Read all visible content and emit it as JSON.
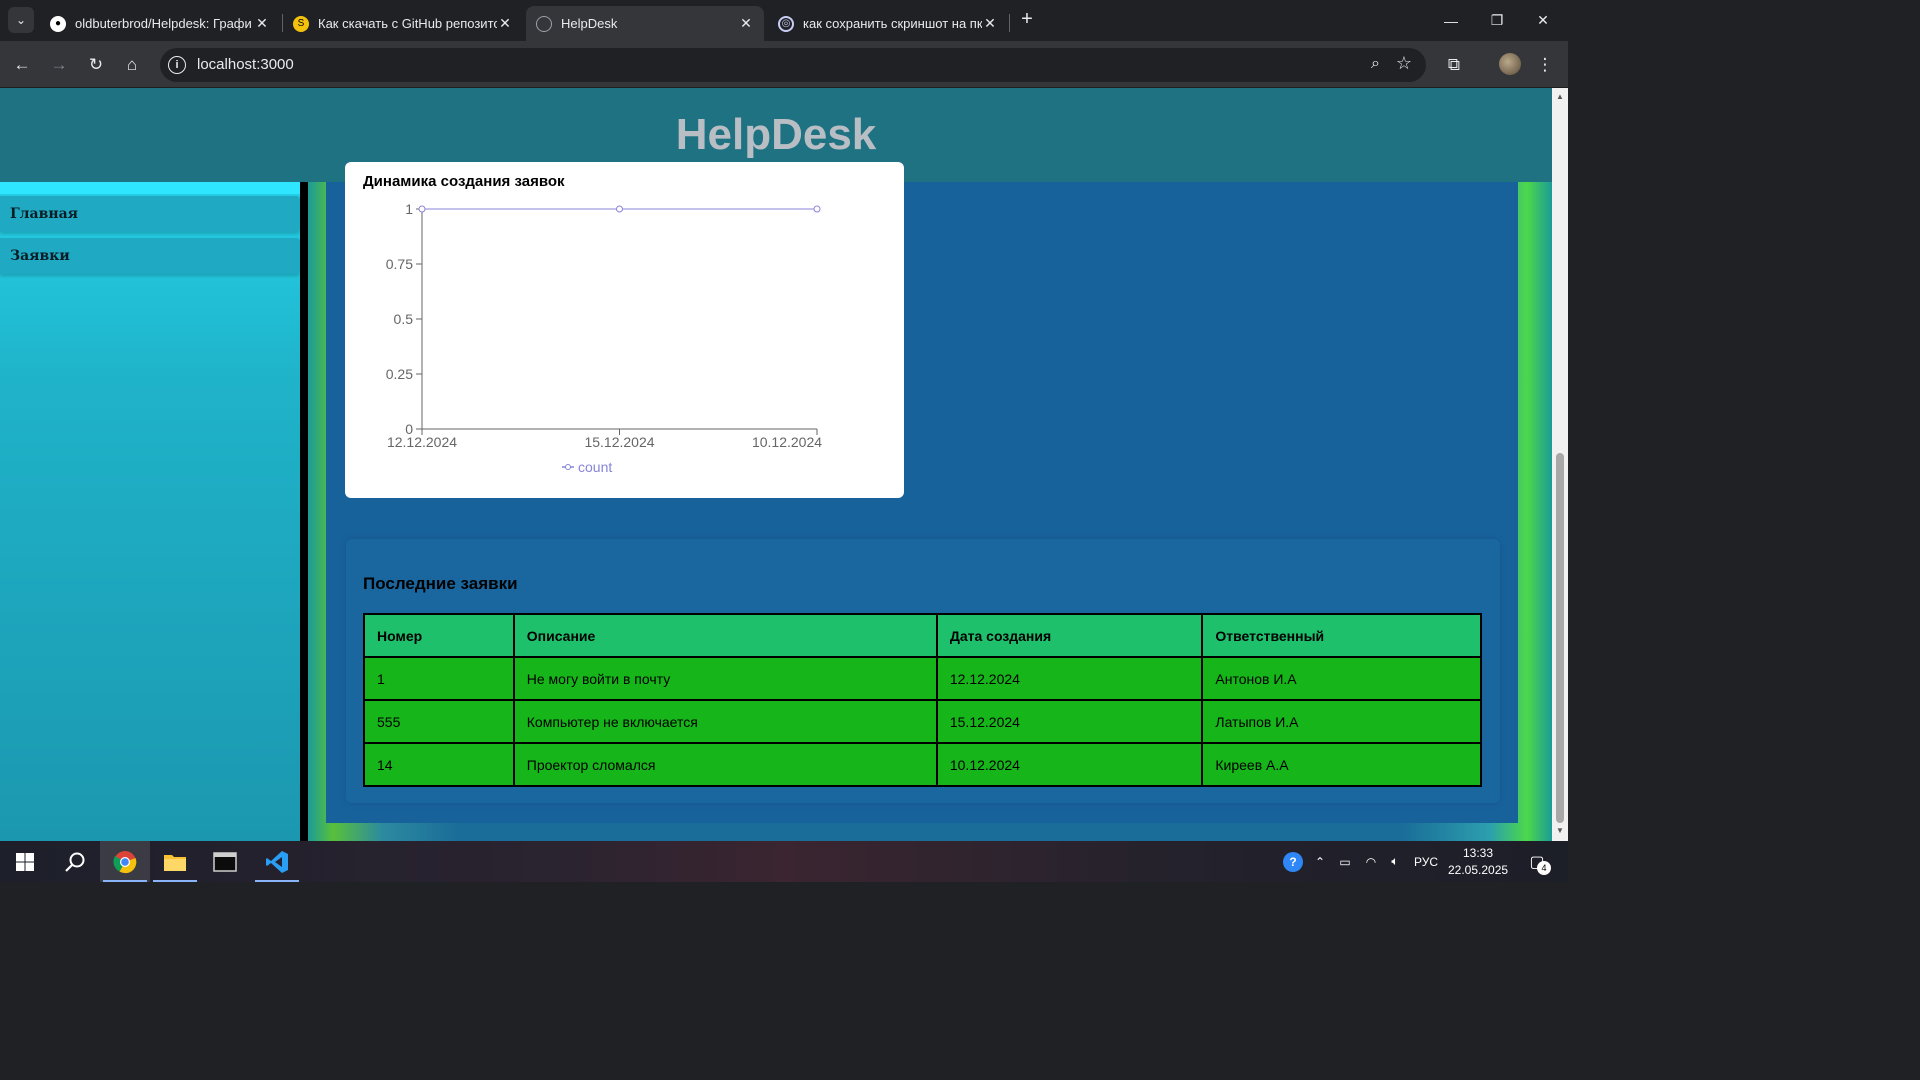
{
  "browser": {
    "tabs": [
      {
        "title": "oldbuterbrod/Helpdesk: Графи",
        "icon": "github-icon",
        "active": false
      },
      {
        "title": "Как скачать с GitHub репозито",
        "icon": "site-s-icon",
        "active": false
      },
      {
        "title": "HelpDesk",
        "icon": "globe-icon",
        "active": true
      },
      {
        "title": "как сохранить скриншот на пк",
        "icon": "search-engine-icon",
        "active": false
      }
    ],
    "url": "localhost:3000"
  },
  "app": {
    "title": "HelpDesk"
  },
  "sidebar": {
    "items": [
      {
        "label": "Главная"
      },
      {
        "label": "Заявки"
      }
    ]
  },
  "chart": {
    "title": "Динамика создания заявок"
  },
  "chart_data": {
    "type": "line",
    "title": "Динамика создания заявок",
    "x": [
      "12.12.2024",
      "15.12.2024",
      "10.12.2024"
    ],
    "series": [
      {
        "name": "count",
        "values": [
          1,
          1,
          1
        ],
        "color": "#8884d8"
      }
    ],
    "yticks": [
      "0",
      "0.25",
      "0.5",
      "0.75",
      "1"
    ],
    "ylim": [
      0,
      1
    ],
    "legend": "bottom",
    "grid": false
  },
  "tickets": {
    "title": "Последние заявки",
    "columns": [
      "Номер",
      "Описание",
      "Дата создания",
      "Ответственный"
    ],
    "rows": [
      [
        "1",
        "Не могу войти в почту",
        "12.12.2024",
        "Антонов И.А"
      ],
      [
        "555",
        "Компьютер не включается",
        "15.12.2024",
        "Латыпов И.А"
      ],
      [
        "14",
        "Проектор сломался",
        "10.12.2024",
        "Киреев А.А"
      ]
    ]
  },
  "taskbar": {
    "language": "РУС",
    "time": "13:33",
    "date": "22.05.2025",
    "notifications": "4"
  },
  "colors": {
    "header": "#1e7282",
    "sidebar": "#1fb3c9",
    "table_header": "#1ec06c",
    "table_row": "#16b51a",
    "chart_line": "#8884d8"
  }
}
